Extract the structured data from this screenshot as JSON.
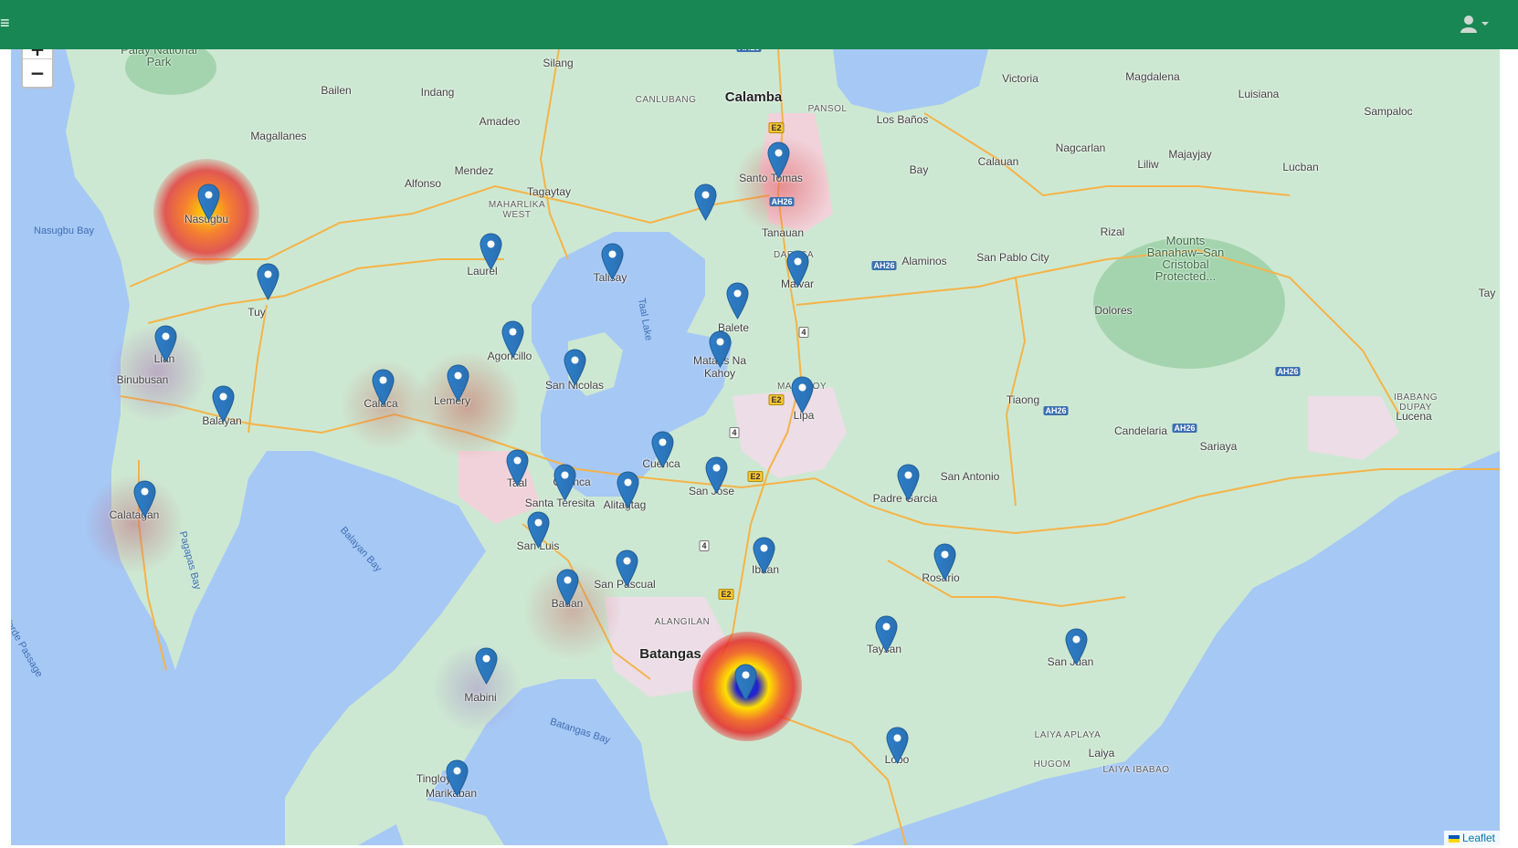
{
  "header": {
    "menu_icon": "hamburger-icon",
    "user_icon": "user-icon",
    "caret_icon": "caret-down-icon",
    "bg_color": "#198754"
  },
  "map": {
    "zoom_in": "+",
    "zoom_out": "−",
    "attribution": "Leaflet",
    "places": [
      "Calamba",
      "Batangas",
      "Palay National Park",
      "Silang",
      "Bailen",
      "Indang",
      "Amadeo",
      "Magallanes",
      "Mendez",
      "Alfonso",
      "Tagaytay",
      "MAHARLIKA WEST",
      "CANLUBANG",
      "PANSOL",
      "Los Baños",
      "Bay",
      "Victoria",
      "Magdalena",
      "Luisiana",
      "Sampaloc",
      "Nagcarlan",
      "Liliw",
      "Majayjay",
      "Lucban",
      "Calauan",
      "Rizal",
      "San Pablo City",
      "Mounts Banahaw–San Cristobal Protected...",
      "Alaminos",
      "Dolores",
      "Tiaong",
      "Candelaria",
      "Sariaya",
      "IBABANG DUPAY",
      "Lucena",
      "Tay",
      "Tanauan",
      "DARASA",
      "Santo Tomas",
      "Nasugbu",
      "Tuy",
      "Lian",
      "Binubusan",
      "Balayan",
      "Calatagan",
      "Calaca",
      "Lemery",
      "Laurel",
      "Talisay",
      "Agoncillo",
      "San Nicolas",
      "Balete",
      "Malvar",
      "Mataas Na Kahoy",
      "MARAUOY",
      "Lipa",
      "Cuenca",
      "San Jose",
      "Taal",
      "Cuenca",
      "Santa Teresita",
      "Alitagtag",
      "San Luis",
      "San Pascual",
      "Bauan",
      "Ibaan",
      "Padre Garcia",
      "San Antonio",
      "Rosario",
      "Taysan",
      "San Juan",
      "ALANGILAN",
      "Mabini",
      "Tingloy",
      "Marikaban",
      "Lobo",
      "LAIYA APLAYA",
      "Laiya",
      "HUGOM",
      "LAIYA IBABAO"
    ],
    "water": [
      "Nasugbu Bay",
      "Balayan Bay",
      "Pagapas Bay",
      "Batangas Bay",
      "Taal Lake",
      "Isla Verde Passage"
    ],
    "markers": [
      "Nasugbu",
      "Tuy",
      "Lian",
      "Balayan",
      "Calatagan",
      "Calaca",
      "Lemery",
      "Laurel",
      "Talisay",
      "Agoncillo",
      "San Nicolas",
      "Santo Tomas",
      "Tanauan",
      "Malvar",
      "Balete",
      "Mataas Na Kahoy",
      "Lipa",
      "Cuenca",
      "San Jose",
      "Taal",
      "Santa Teresita",
      "Alitagtag",
      "San Luis",
      "San Pascual",
      "Bauan",
      "Ibaan",
      "Padre Garcia",
      "Rosario",
      "Taysan",
      "San Juan",
      "Batangas City",
      "Mabini",
      "Tingloy",
      "Lobo"
    ]
  }
}
